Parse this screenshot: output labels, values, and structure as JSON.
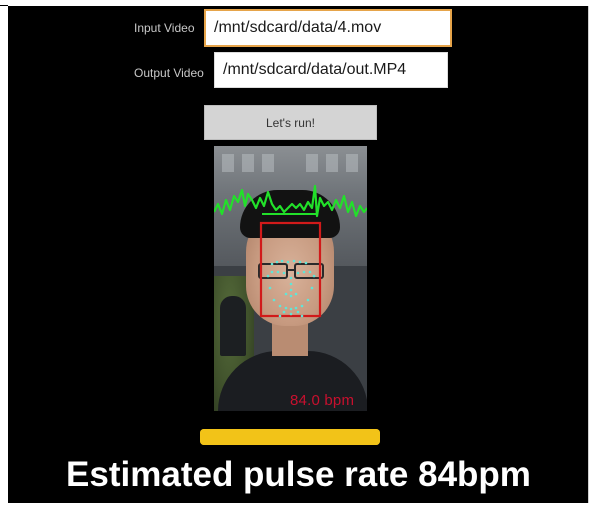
{
  "form": {
    "input_video_label": "Input Video",
    "input_video_value": "/mnt/sdcard/data/4.mov",
    "output_video_label": "Output Video",
    "output_video_value": "/mnt/sdcard/data/out.MP4",
    "run_button_label": "Let's run!"
  },
  "video": {
    "bpm_readout": "84.0 bpm",
    "colors": {
      "pulse_waveform": "#22e02a",
      "face_box": "#d11a1a",
      "landmarks": "#5ee6d8"
    }
  },
  "progress": {
    "fraction": 1.0,
    "color": "#f2c318"
  },
  "caption": {
    "text": "Estimated pulse rate 84bpm"
  }
}
